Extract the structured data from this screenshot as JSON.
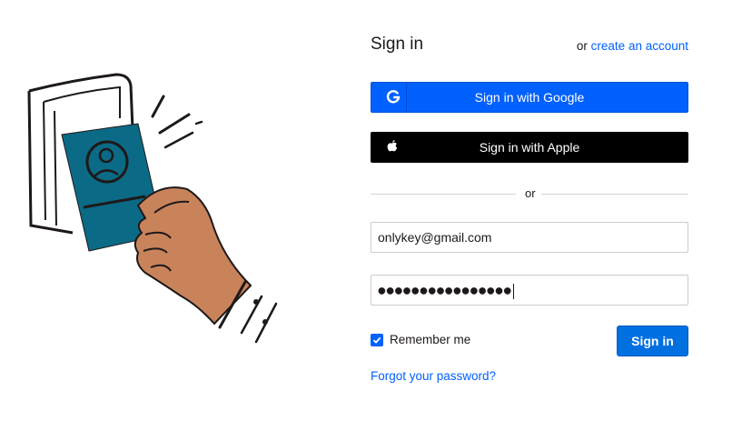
{
  "header": {
    "title": "Sign in",
    "or_text": "or",
    "create_account": "create an account"
  },
  "sso": {
    "google_label": "Sign in with Google",
    "google_icon": "google-icon",
    "apple_label": "Sign in with Apple",
    "apple_icon": "apple-icon"
  },
  "divider": {
    "text": "or"
  },
  "form": {
    "email_value": "onlykey@gmail.com",
    "password_mask": "●●●●●●●●●●●●●●●●",
    "remember_label": "Remember me",
    "remember_checked": true,
    "submit_label": "Sign in",
    "forgot_link": "Forgot your password?"
  },
  "colors": {
    "link": "#0061fe",
    "google_button": "#0061fe",
    "apple_button": "#000000",
    "submit_button": "#0070e0",
    "passport": "#0b6a86",
    "hand": "#c9835b"
  }
}
